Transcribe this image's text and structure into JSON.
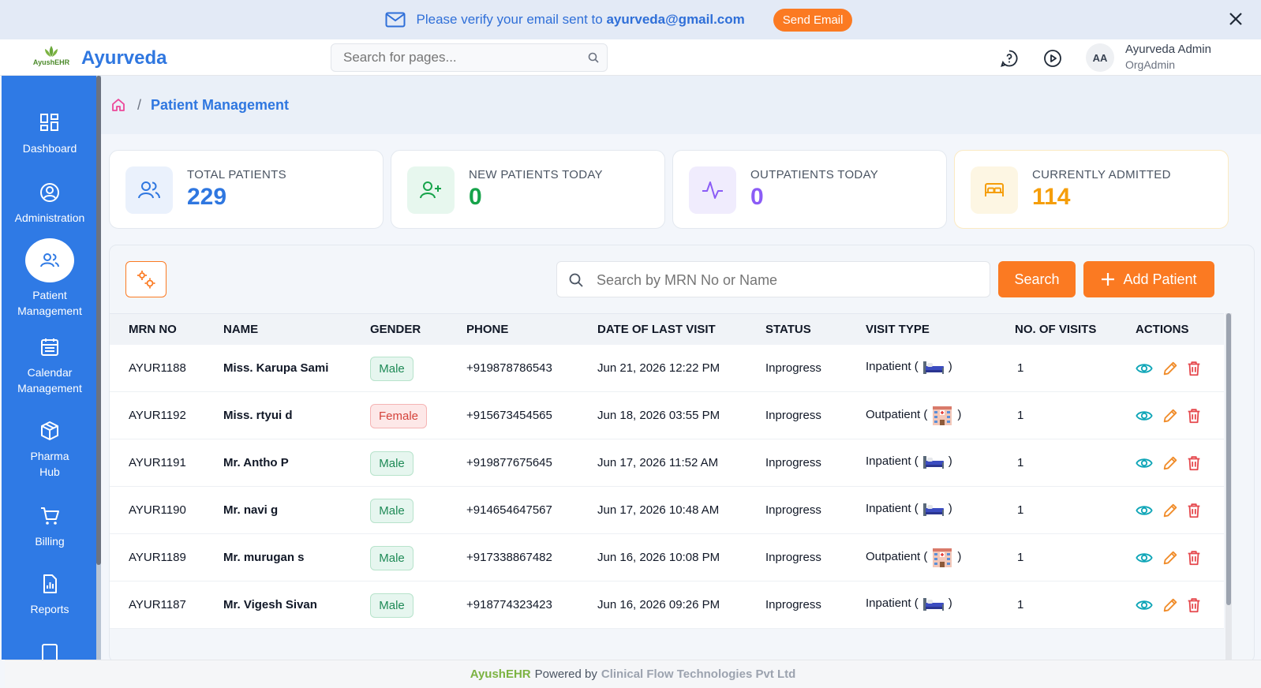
{
  "banner": {
    "message": "Please verify your email sent to",
    "email": "ayurveda@gmail.com",
    "send_button": "Send Email",
    "icons": {
      "mail": "mail-icon",
      "close": "close-icon"
    }
  },
  "header": {
    "logo_text": "AyushEHR",
    "app_title": "Ayurveda",
    "search_placeholder": "Search for pages...",
    "user": {
      "initials": "AA",
      "name": "Ayurveda Admin",
      "role": "OrgAdmin"
    },
    "icons": [
      "help-chat-icon",
      "play-icon"
    ]
  },
  "sidebar": {
    "items": [
      {
        "label": "Dashboard",
        "icon": "dashboard-icon"
      },
      {
        "label": "Administration",
        "icon": "user-circle-icon"
      },
      {
        "label": "Patient Management",
        "icon": "users-icon",
        "active": true
      },
      {
        "label": "Calendar Management",
        "icon": "calendar-icon"
      },
      {
        "label": "Pharma Hub",
        "icon": "box-icon"
      },
      {
        "label": "Billing",
        "icon": "cart-icon"
      },
      {
        "label": "Reports",
        "icon": "report-icon"
      }
    ]
  },
  "breadcrumb": {
    "current": "Patient Management"
  },
  "stats": [
    {
      "label": "TOTAL PATIENTS",
      "value": "229",
      "color": "#2f77e0"
    },
    {
      "label": "NEW PATIENTS TODAY",
      "value": "0",
      "color": "#16a34a"
    },
    {
      "label": "OUTPATIENTS TODAY",
      "value": "0",
      "color": "#8b5cf6"
    },
    {
      "label": "CURRENTLY ADMITTED",
      "value": "114",
      "color": "#f59e0b"
    }
  ],
  "table": {
    "search_placeholder": "Search by MRN No or Name",
    "search_button": "Search",
    "add_button": "Add Patient",
    "columns": [
      "MRN NO",
      "NAME",
      "GENDER",
      "PHONE",
      "DATE OF LAST VISIT",
      "STATUS",
      "VISIT TYPE",
      "NO. OF VISITS",
      "ACTIONS"
    ],
    "rows": [
      {
        "mrn": "AYUR1188",
        "name": "Miss. Karupa Sami",
        "gender": "Male",
        "phone": "+919878786543",
        "last_visit": "Jun 21, 2026 12:22 PM",
        "status": "Inprogress",
        "visit_type": "Inpatient",
        "visits": "1"
      },
      {
        "mrn": "AYUR1192",
        "name": "Miss. rtyui d",
        "gender": "Female",
        "phone": "+915673454565",
        "last_visit": "Jun 18, 2026 03:55 PM",
        "status": "Inprogress",
        "visit_type": "Outpatient",
        "visits": "1"
      },
      {
        "mrn": "AYUR1191",
        "name": "Mr. Antho P",
        "gender": "Male",
        "phone": "+919877675645",
        "last_visit": "Jun 17, 2026 11:52 AM",
        "status": "Inprogress",
        "visit_type": "Inpatient",
        "visits": "1"
      },
      {
        "mrn": "AYUR1190",
        "name": "Mr. navi g",
        "gender": "Male",
        "phone": "+914654647567",
        "last_visit": "Jun 17, 2026 10:48 AM",
        "status": "Inprogress",
        "visit_type": "Inpatient",
        "visits": "1"
      },
      {
        "mrn": "AYUR1189",
        "name": "Mr. murugan s",
        "gender": "Male",
        "phone": "+917338867482",
        "last_visit": "Jun 16, 2026 10:08 PM",
        "status": "Inprogress",
        "visit_type": "Outpatient",
        "visits": "1"
      },
      {
        "mrn": "AYUR1187",
        "name": "Mr. Vigesh Sivan",
        "gender": "Male",
        "phone": "+918774323423",
        "last_visit": "Jun 16, 2026 09:26 PM",
        "status": "Inprogress",
        "visit_type": "Inpatient",
        "visits": "1"
      }
    ]
  },
  "footer": {
    "brand": "AyushEHR",
    "text": "Powered by",
    "company": "Clinical Flow Technologies Pvt Ltd"
  }
}
